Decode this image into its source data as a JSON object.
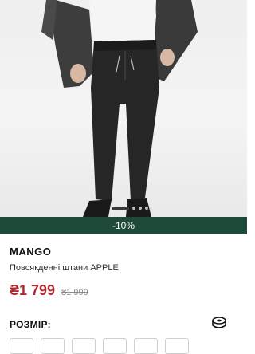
{
  "product": {
    "brand": "MANGO",
    "name": "Повсякденні штани APPLE",
    "discount_badge": "-10%",
    "price_current": "₴1 799",
    "price_old": "₴1 999"
  },
  "gallery": {
    "dots_count": 5,
    "active_index": 0
  },
  "size_section": {
    "label": "РОЗМІР:",
    "guide_icon": "measuring-tape-icon",
    "options_visible": 6
  },
  "colors": {
    "discount_bar": "#1f4a3a",
    "price": "#b3282d"
  }
}
